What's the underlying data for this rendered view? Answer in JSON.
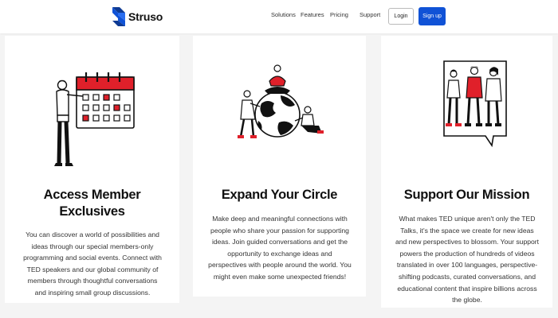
{
  "brand": {
    "name": "Struso",
    "color": "#1052d6"
  },
  "nav": {
    "links": [
      "Solutions",
      "Features",
      "Pricing",
      "Support"
    ],
    "login_label": "Login",
    "signup_label": "Sign up"
  },
  "cards": [
    {
      "title_line1": "Access Member",
      "title_line2": "Exclusives",
      "body": "You can discover a world of possibilities and ideas through our special members-only programming and social events. Connect with TED speakers and our global community of members through thoughtful conversations and inspiring small group discussions.",
      "illustration": "calendar-person-illustration"
    },
    {
      "title": "Expand Your Circle",
      "body": "Make deep and meaningful connections with people who share your passion for supporting ideas. Join guided conversations and get the opportunity to exchange ideas and perspectives with people around the world. You might even make some unexpected friends!",
      "illustration": "people-around-globe-illustration"
    },
    {
      "title": "Support Our Mission",
      "body": "What makes TED unique aren't only the TED Talks, it's the space we create for new ideas and new perspectives to blossom. Your support powers the production of hundreds of videos translated in over 100 languages, perspective-shifting podcasts, curated conversations, and educational content that inspire billions across the globe.",
      "illustration": "speech-bubble-people-illustration"
    }
  ],
  "colors": {
    "accent": "#e0202a",
    "ink": "#111111",
    "background": "#f4f4f4"
  }
}
